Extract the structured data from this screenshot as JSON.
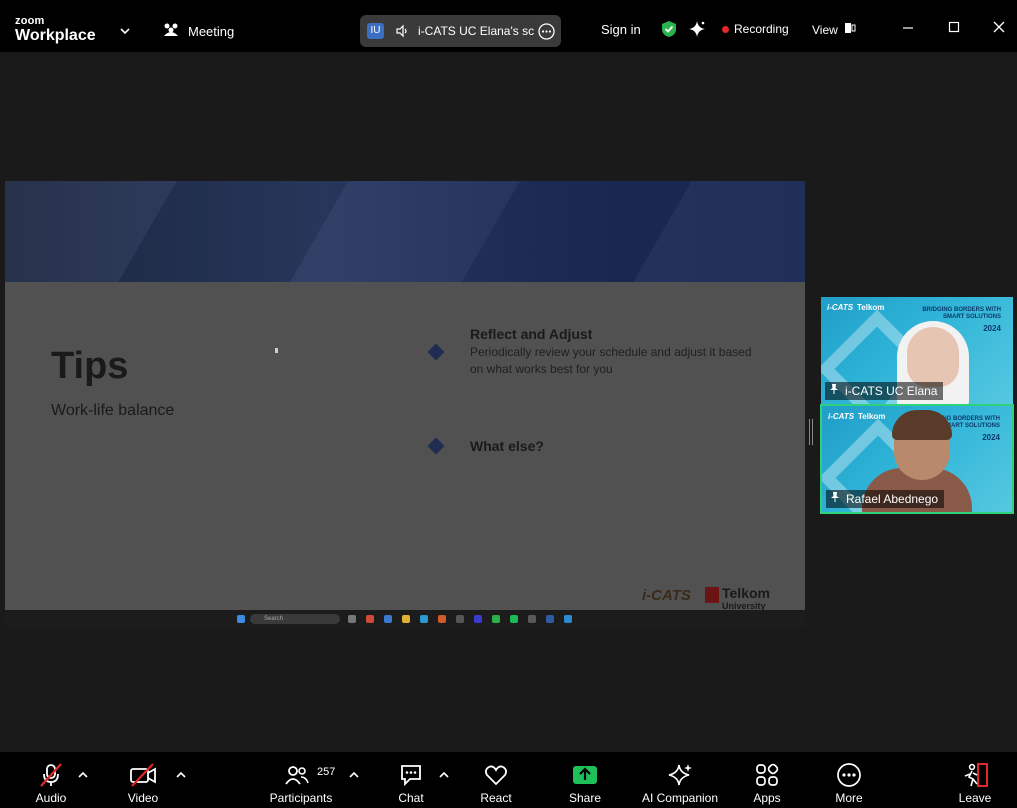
{
  "topbar": {
    "logo_top": "zoom",
    "logo_bottom": "Workplace",
    "meeting_label": "Meeting",
    "share_badge": "IU",
    "share_title": "i-CATS UC Elana's scr",
    "sign_in": "Sign in",
    "recording": "Recording",
    "view": "View"
  },
  "slide": {
    "title": "Tips",
    "subtitle": "Work-life balance",
    "tips": [
      {
        "heading": "Reflect and Adjust",
        "body": "Periodically review your schedule and adjust it based on what works best for you"
      },
      {
        "heading": "What else?",
        "body": ""
      }
    ],
    "brand_left": "i-CATS",
    "brand_right": "Telkom",
    "brand_right_sub": "University",
    "taskbar_search": "Search"
  },
  "participants_tiles": [
    {
      "name": "i-CATS UC Elana",
      "banner_l": "i-CATS",
      "banner_r": "Telkom",
      "banner_text": "BRIDGING BORDERS WITH SMART SOLUTIONS",
      "year": "2024"
    },
    {
      "name": "Rafael Abednego",
      "banner_l": "i-CATS",
      "banner_r": "Telkom",
      "banner_text": "BRIDGING BORDERS WITH SMART SOLUTIONS",
      "year": "2024"
    }
  ],
  "toolbar": {
    "audio": "Audio",
    "video": "Video",
    "participants": "Participants",
    "participant_count": "257",
    "chat": "Chat",
    "react": "React",
    "share": "Share",
    "ai_companion": "AI Companion",
    "apps": "Apps",
    "more": "More",
    "leave": "Leave"
  },
  "colors": {
    "share_green": "#1fbf5a",
    "recording_red": "#e02828",
    "active_speaker": "#2fd27a",
    "shield_green": "#2bb24c"
  }
}
